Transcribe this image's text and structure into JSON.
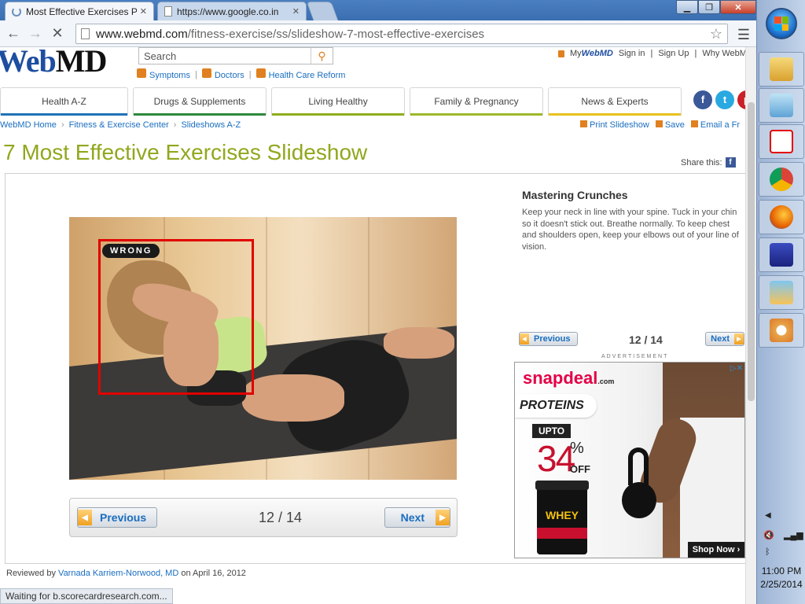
{
  "browser": {
    "tabs": [
      {
        "title": "Most Effective Exercises Pi",
        "active": true
      },
      {
        "title": "https://www.google.co.in",
        "active": false
      }
    ],
    "url": {
      "host": "www.webmd.com",
      "path": "/fitness-exercise/ss/slideshow-7-most-effective-exercises"
    },
    "status": "Waiting for b.scorecardresearch.com..."
  },
  "header": {
    "logo": {
      "web": "Web",
      "md": "MD"
    },
    "search_placeholder": "Search",
    "quicklinks": [
      "Symptoms",
      "Doctors",
      "Health Care Reform"
    ],
    "mywebmd": {
      "my": "My",
      "brand": "WebMD"
    },
    "toplinks": [
      "Sign in",
      "Sign Up",
      "Why WebM"
    ],
    "nav": [
      "Health A-Z",
      "Drugs & Supplements",
      "Living Healthy",
      "Family & Pregnancy",
      "News & Experts"
    ],
    "nav_colors": [
      "#1f73b7",
      "#2d8a3c",
      "#8fae1b",
      "#9cb82a",
      "#e8c21d"
    ]
  },
  "breadcrumb": [
    "WebMD Home",
    "Fitness & Exercise Center",
    "Slideshows A-Z"
  ],
  "page_tools": [
    "Print Slideshow",
    "Save",
    "Email a Fr"
  ],
  "page_title": "7 Most Effective Exercises Slideshow",
  "share_label": "Share this:",
  "slide": {
    "badge": "WRONG",
    "heading": "Mastering Crunches",
    "text": "Keep your neck in line with your spine. Tuck in your chin so it doesn't stick out. Breathe normally. To keep chest and shoulders open, keep your elbows out of your line of vision.",
    "previous": "Previous",
    "next": "Next",
    "counter": "12 / 14"
  },
  "ad": {
    "label": "ADVERTISEMENT",
    "brand": "snapdeal",
    "brand_suffix": ".com",
    "headline": "PROTEINS",
    "upto": "UPTO",
    "discount": "34",
    "percent": "%",
    "off": "OFF",
    "product": "WHEY",
    "cta": "Shop Now ›"
  },
  "reviewed": {
    "prefix": "Reviewed by",
    "reviewer": "Varnada Karriem-Norwood, MD",
    "suffix": "on April 16, 2012"
  },
  "taskbar": {
    "time": "11:00 PM",
    "date": "2/25/2014"
  }
}
